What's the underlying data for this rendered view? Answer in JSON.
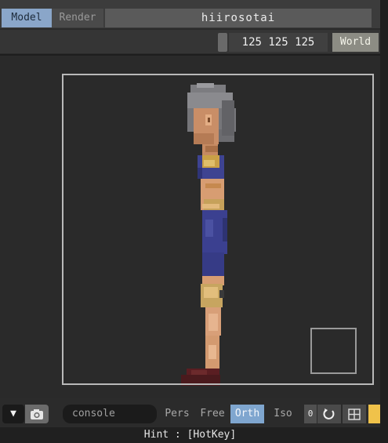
{
  "tabs": [
    {
      "label": "Model"
    },
    {
      "label": "Render"
    }
  ],
  "document": {
    "title": "hiirosotai"
  },
  "size": {
    "value": "125 125 125"
  },
  "space_toggle": {
    "label": "World"
  },
  "console": {
    "placeholder": "console"
  },
  "view_modes": [
    {
      "label": "Pers"
    },
    {
      "label": "Free"
    },
    {
      "label": "Orth",
      "active": true
    },
    {
      "label": "Iso"
    }
  ],
  "toolbar": {
    "dropdown_glyph": "▼",
    "camera_icon": "camera-icon",
    "zero_label": "0",
    "rotate_icon": "rotate-icon",
    "grid_icon": "grid-icon"
  },
  "colors": {
    "accent_blue": "#7fa6cf",
    "palette_swatch": "#f0c24a"
  },
  "hint": {
    "text": "Hint : [HotKey]"
  }
}
